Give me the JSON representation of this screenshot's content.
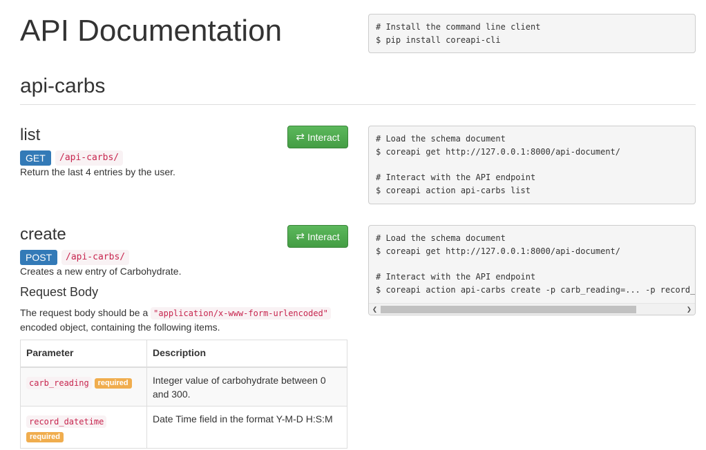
{
  "page": {
    "title": "API Documentation",
    "install_code": [
      "# Install the command line client",
      "$ pip install coreapi-cli"
    ]
  },
  "group": {
    "title": "api-carbs"
  },
  "endpoints": [
    {
      "name": "list",
      "interact_label": "Interact",
      "method": "GET",
      "path": "/api-carbs/",
      "description": "Return the last 4 entries by the user.",
      "code": [
        "# Load the schema document",
        "$ coreapi get http://127.0.0.1:8000/api-document/",
        "",
        "# Interact with the API endpoint",
        "$ coreapi action api-carbs list"
      ]
    },
    {
      "name": "create",
      "interact_label": "Interact",
      "method": "POST",
      "path": "/api-carbs/",
      "description": "Creates a new entry of Carbohydrate.",
      "code": [
        "# Load the schema document",
        "$ coreapi get http://127.0.0.1:8000/api-document/",
        "",
        "# Interact with the API endpoint",
        "$ coreapi action api-carbs create -p carb_reading=... -p record_datetime=..."
      ],
      "request_body": {
        "title": "Request Body",
        "text_before": "The request body should be a ",
        "content_type": "\"application/x-www-form-urlencoded\"",
        "text_after": "encoded object, containing the following items."
      },
      "params_table": {
        "headers": [
          "Parameter",
          "Description"
        ],
        "required_label": "required",
        "rows": [
          {
            "name": "carb_reading",
            "description": "Integer value of carbohydrate between 0 and 300."
          },
          {
            "name": "record_datetime",
            "description": "Date Time field in the format Y-M-D H:S:M"
          }
        ]
      }
    }
  ],
  "icons": {
    "interact": "exchange-arrows-icon",
    "scroll_left": "chevron-left-icon",
    "scroll_right": "chevron-right-icon"
  },
  "colors": {
    "button_green": "#5cb85c",
    "method_blue": "#337ab7",
    "code_red": "#c7254e",
    "required_orange": "#f0ad4e"
  }
}
